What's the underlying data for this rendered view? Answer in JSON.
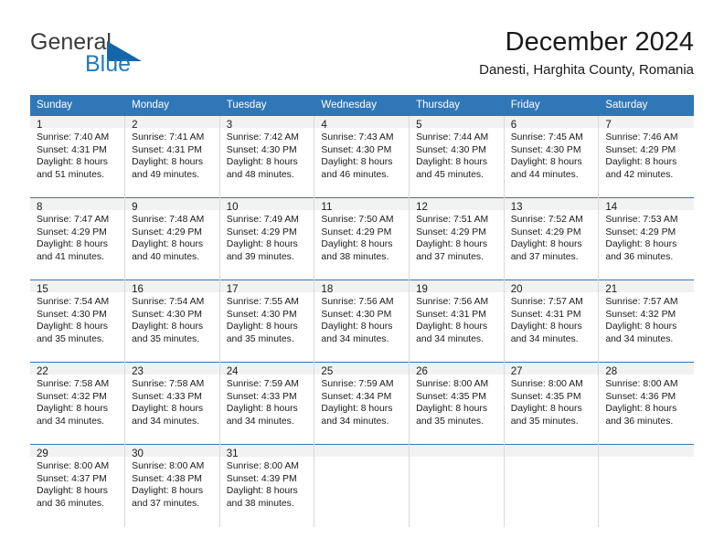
{
  "brand": {
    "name_part1": "General",
    "name_part2": "Blue",
    "flag_icon": "blue-flag-icon"
  },
  "header": {
    "month_title": "December 2024",
    "location": "Danesti, Harghita County, Romania"
  },
  "colors": {
    "header_blue": "#3077b8",
    "daynum_gray": "#f2f2f2",
    "brand_blue": "#1f7ac0",
    "text": "#1a1a1a"
  },
  "calendar": {
    "weekday_headers": [
      "Sunday",
      "Monday",
      "Tuesday",
      "Wednesday",
      "Thursday",
      "Friday",
      "Saturday"
    ],
    "weeks": [
      [
        {
          "day": "1",
          "sunrise": "Sunrise: 7:40 AM",
          "sunset": "Sunset: 4:31 PM",
          "daylight1": "Daylight: 8 hours",
          "daylight2": "and 51 minutes."
        },
        {
          "day": "2",
          "sunrise": "Sunrise: 7:41 AM",
          "sunset": "Sunset: 4:31 PM",
          "daylight1": "Daylight: 8 hours",
          "daylight2": "and 49 minutes."
        },
        {
          "day": "3",
          "sunrise": "Sunrise: 7:42 AM",
          "sunset": "Sunset: 4:30 PM",
          "daylight1": "Daylight: 8 hours",
          "daylight2": "and 48 minutes."
        },
        {
          "day": "4",
          "sunrise": "Sunrise: 7:43 AM",
          "sunset": "Sunset: 4:30 PM",
          "daylight1": "Daylight: 8 hours",
          "daylight2": "and 46 minutes."
        },
        {
          "day": "5",
          "sunrise": "Sunrise: 7:44 AM",
          "sunset": "Sunset: 4:30 PM",
          "daylight1": "Daylight: 8 hours",
          "daylight2": "and 45 minutes."
        },
        {
          "day": "6",
          "sunrise": "Sunrise: 7:45 AM",
          "sunset": "Sunset: 4:30 PM",
          "daylight1": "Daylight: 8 hours",
          "daylight2": "and 44 minutes."
        },
        {
          "day": "7",
          "sunrise": "Sunrise: 7:46 AM",
          "sunset": "Sunset: 4:29 PM",
          "daylight1": "Daylight: 8 hours",
          "daylight2": "and 42 minutes."
        }
      ],
      [
        {
          "day": "8",
          "sunrise": "Sunrise: 7:47 AM",
          "sunset": "Sunset: 4:29 PM",
          "daylight1": "Daylight: 8 hours",
          "daylight2": "and 41 minutes."
        },
        {
          "day": "9",
          "sunrise": "Sunrise: 7:48 AM",
          "sunset": "Sunset: 4:29 PM",
          "daylight1": "Daylight: 8 hours",
          "daylight2": "and 40 minutes."
        },
        {
          "day": "10",
          "sunrise": "Sunrise: 7:49 AM",
          "sunset": "Sunset: 4:29 PM",
          "daylight1": "Daylight: 8 hours",
          "daylight2": "and 39 minutes."
        },
        {
          "day": "11",
          "sunrise": "Sunrise: 7:50 AM",
          "sunset": "Sunset: 4:29 PM",
          "daylight1": "Daylight: 8 hours",
          "daylight2": "and 38 minutes."
        },
        {
          "day": "12",
          "sunrise": "Sunrise: 7:51 AM",
          "sunset": "Sunset: 4:29 PM",
          "daylight1": "Daylight: 8 hours",
          "daylight2": "and 37 minutes."
        },
        {
          "day": "13",
          "sunrise": "Sunrise: 7:52 AM",
          "sunset": "Sunset: 4:29 PM",
          "daylight1": "Daylight: 8 hours",
          "daylight2": "and 37 minutes."
        },
        {
          "day": "14",
          "sunrise": "Sunrise: 7:53 AM",
          "sunset": "Sunset: 4:29 PM",
          "daylight1": "Daylight: 8 hours",
          "daylight2": "and 36 minutes."
        }
      ],
      [
        {
          "day": "15",
          "sunrise": "Sunrise: 7:54 AM",
          "sunset": "Sunset: 4:30 PM",
          "daylight1": "Daylight: 8 hours",
          "daylight2": "and 35 minutes."
        },
        {
          "day": "16",
          "sunrise": "Sunrise: 7:54 AM",
          "sunset": "Sunset: 4:30 PM",
          "daylight1": "Daylight: 8 hours",
          "daylight2": "and 35 minutes."
        },
        {
          "day": "17",
          "sunrise": "Sunrise: 7:55 AM",
          "sunset": "Sunset: 4:30 PM",
          "daylight1": "Daylight: 8 hours",
          "daylight2": "and 35 minutes."
        },
        {
          "day": "18",
          "sunrise": "Sunrise: 7:56 AM",
          "sunset": "Sunset: 4:30 PM",
          "daylight1": "Daylight: 8 hours",
          "daylight2": "and 34 minutes."
        },
        {
          "day": "19",
          "sunrise": "Sunrise: 7:56 AM",
          "sunset": "Sunset: 4:31 PM",
          "daylight1": "Daylight: 8 hours",
          "daylight2": "and 34 minutes."
        },
        {
          "day": "20",
          "sunrise": "Sunrise: 7:57 AM",
          "sunset": "Sunset: 4:31 PM",
          "daylight1": "Daylight: 8 hours",
          "daylight2": "and 34 minutes."
        },
        {
          "day": "21",
          "sunrise": "Sunrise: 7:57 AM",
          "sunset": "Sunset: 4:32 PM",
          "daylight1": "Daylight: 8 hours",
          "daylight2": "and 34 minutes."
        }
      ],
      [
        {
          "day": "22",
          "sunrise": "Sunrise: 7:58 AM",
          "sunset": "Sunset: 4:32 PM",
          "daylight1": "Daylight: 8 hours",
          "daylight2": "and 34 minutes."
        },
        {
          "day": "23",
          "sunrise": "Sunrise: 7:58 AM",
          "sunset": "Sunset: 4:33 PM",
          "daylight1": "Daylight: 8 hours",
          "daylight2": "and 34 minutes."
        },
        {
          "day": "24",
          "sunrise": "Sunrise: 7:59 AM",
          "sunset": "Sunset: 4:33 PM",
          "daylight1": "Daylight: 8 hours",
          "daylight2": "and 34 minutes."
        },
        {
          "day": "25",
          "sunrise": "Sunrise: 7:59 AM",
          "sunset": "Sunset: 4:34 PM",
          "daylight1": "Daylight: 8 hours",
          "daylight2": "and 34 minutes."
        },
        {
          "day": "26",
          "sunrise": "Sunrise: 8:00 AM",
          "sunset": "Sunset: 4:35 PM",
          "daylight1": "Daylight: 8 hours",
          "daylight2": "and 35 minutes."
        },
        {
          "day": "27",
          "sunrise": "Sunrise: 8:00 AM",
          "sunset": "Sunset: 4:35 PM",
          "daylight1": "Daylight: 8 hours",
          "daylight2": "and 35 minutes."
        },
        {
          "day": "28",
          "sunrise": "Sunrise: 8:00 AM",
          "sunset": "Sunset: 4:36 PM",
          "daylight1": "Daylight: 8 hours",
          "daylight2": "and 36 minutes."
        }
      ],
      [
        {
          "day": "29",
          "sunrise": "Sunrise: 8:00 AM",
          "sunset": "Sunset: 4:37 PM",
          "daylight1": "Daylight: 8 hours",
          "daylight2": "and 36 minutes."
        },
        {
          "day": "30",
          "sunrise": "Sunrise: 8:00 AM",
          "sunset": "Sunset: 4:38 PM",
          "daylight1": "Daylight: 8 hours",
          "daylight2": "and 37 minutes."
        },
        {
          "day": "31",
          "sunrise": "Sunrise: 8:00 AM",
          "sunset": "Sunset: 4:39 PM",
          "daylight1": "Daylight: 8 hours",
          "daylight2": "and 38 minutes."
        },
        {
          "day": "",
          "sunrise": "",
          "sunset": "",
          "daylight1": "",
          "daylight2": ""
        },
        {
          "day": "",
          "sunrise": "",
          "sunset": "",
          "daylight1": "",
          "daylight2": ""
        },
        {
          "day": "",
          "sunrise": "",
          "sunset": "",
          "daylight1": "",
          "daylight2": ""
        },
        {
          "day": "",
          "sunrise": "",
          "sunset": "",
          "daylight1": "",
          "daylight2": ""
        }
      ]
    ]
  }
}
